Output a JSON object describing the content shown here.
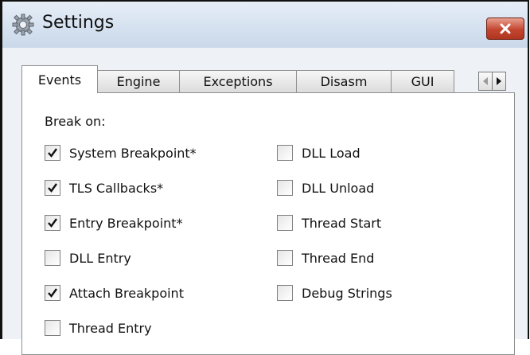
{
  "window": {
    "title": "Settings",
    "title_icon": "gear-icon",
    "close_icon": "close-icon",
    "close_color": "#c3452f"
  },
  "tabs": [
    {
      "label": "Events",
      "active": true
    },
    {
      "label": "Engine",
      "active": false
    },
    {
      "label": "Exceptions",
      "active": false
    },
    {
      "label": "Disasm",
      "active": false
    },
    {
      "label": "GUI",
      "active": false
    }
  ],
  "tab_scroll": {
    "left_icon": "arrow-left-icon",
    "right_icon": "arrow-right-icon"
  },
  "events": {
    "group_label": "Break on:",
    "left_column": [
      {
        "label": "System Breakpoint*",
        "checked": true
      },
      {
        "label": "TLS Callbacks*",
        "checked": true
      },
      {
        "label": "Entry Breakpoint*",
        "checked": true
      },
      {
        "label": "DLL Entry",
        "checked": false
      },
      {
        "label": "Attach Breakpoint",
        "checked": true
      },
      {
        "label": "Thread Entry",
        "checked": false
      }
    ],
    "right_column": [
      {
        "label": "DLL Load",
        "checked": false
      },
      {
        "label": "DLL Unload",
        "checked": false
      },
      {
        "label": "Thread Start",
        "checked": false
      },
      {
        "label": "Thread End",
        "checked": false
      },
      {
        "label": "Debug Strings",
        "checked": false
      }
    ]
  }
}
